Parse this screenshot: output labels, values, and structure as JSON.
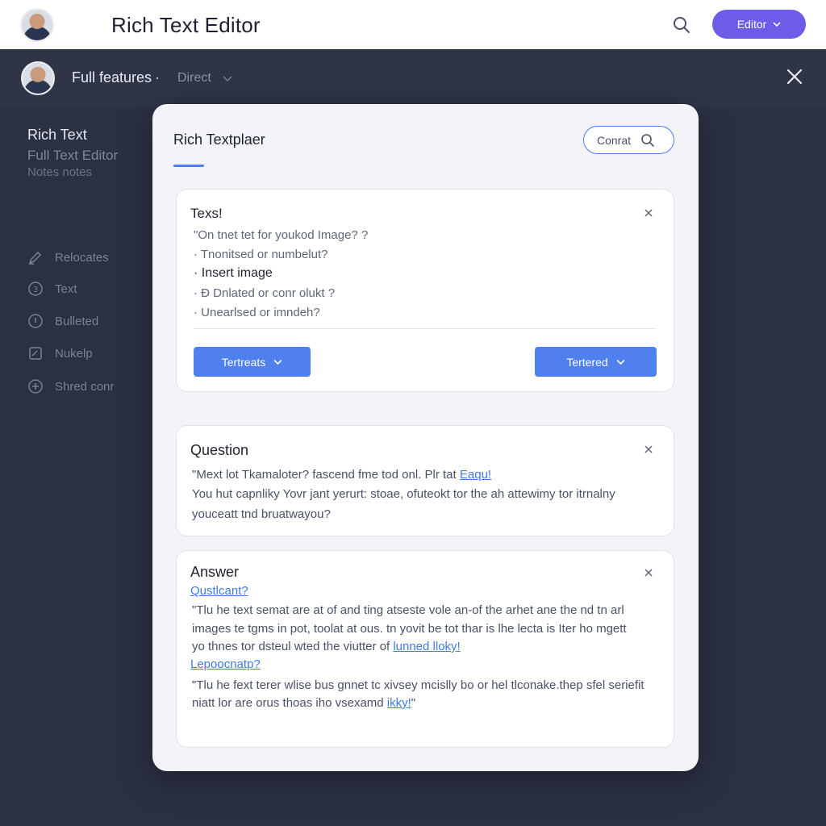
{
  "topbar": {
    "title": "Rich Text Editor",
    "search_icon": "search-icon",
    "editor_button": "Editor"
  },
  "subbar": {
    "title": "Full features",
    "crumb": "Direct"
  },
  "left_panel": {
    "title": "Rich Text",
    "subtitle1": "Full Text Editor",
    "subtitle2": "Notes notes",
    "nav": [
      {
        "label": "Relocates",
        "icon": "edit-icon"
      },
      {
        "label": "Text",
        "icon": "text-circle-icon"
      },
      {
        "label": "Bulleted",
        "icon": "info-circle-icon"
      },
      {
        "label": "Nukelp",
        "icon": "note-icon"
      },
      {
        "label": "Shred conr",
        "icon": "plus-circle-icon"
      }
    ]
  },
  "modal": {
    "title": "Rich Textplaer",
    "contact_button": "Conrat",
    "card1": {
      "heading": "Texs!",
      "lines": [
        "\"On tnet tet for youkod  Image? ?",
        "· Tnonitsed or numbelut?",
        "· Insert image",
        "· Ð Dnlated or conr olukt ?",
        "· Unearlsed or imndeh?"
      ],
      "pill_left": "Tertreats",
      "pill_right": "Tertered"
    },
    "card2": {
      "heading": "Question",
      "line1_text": "\"Mext lot Tkamaloter? fascend fme tod onl. Plr tat ",
      "line1_link": "Eaqu!",
      "line2": "You hut capnliky Yovr jant yerurt: stoae, ofuteokt tor the ah attewimy tor itrnalny",
      "line3": "youceatt tnd bruatwayou?"
    },
    "card3": {
      "heading": "Answer",
      "link1": "Qustlcant?",
      "para1_line1": "\"Tlu he text semat are at of and ting atseste vole an-of the arhet ane the nd tn arl",
      "para1_line2": "images te tgms in pot, toolat at ous. tn yovit be tot thar is lhe lecta is Iter ho mgett",
      "para1_line3_text": "yo thnes tor dsteul wted the viutter of ",
      "para1_line3_link": "lunned lloky!",
      "link2": "Lepoocnatp?",
      "para2_line1": "\"Tlu he fext terer wlise bus gnnet tc xivsey mcislly bo or hel tlconake.thep sfel seriefit",
      "para2_line2_text": "niatt lor are orus thoas iho vsexamd ",
      "para2_line2_link": "ikky!",
      "para2_line2_end": "\""
    }
  },
  "colors": {
    "accent_purple": "#6c5ce7",
    "accent_blue": "#4f80ee",
    "background_dark": "#2b3043"
  }
}
